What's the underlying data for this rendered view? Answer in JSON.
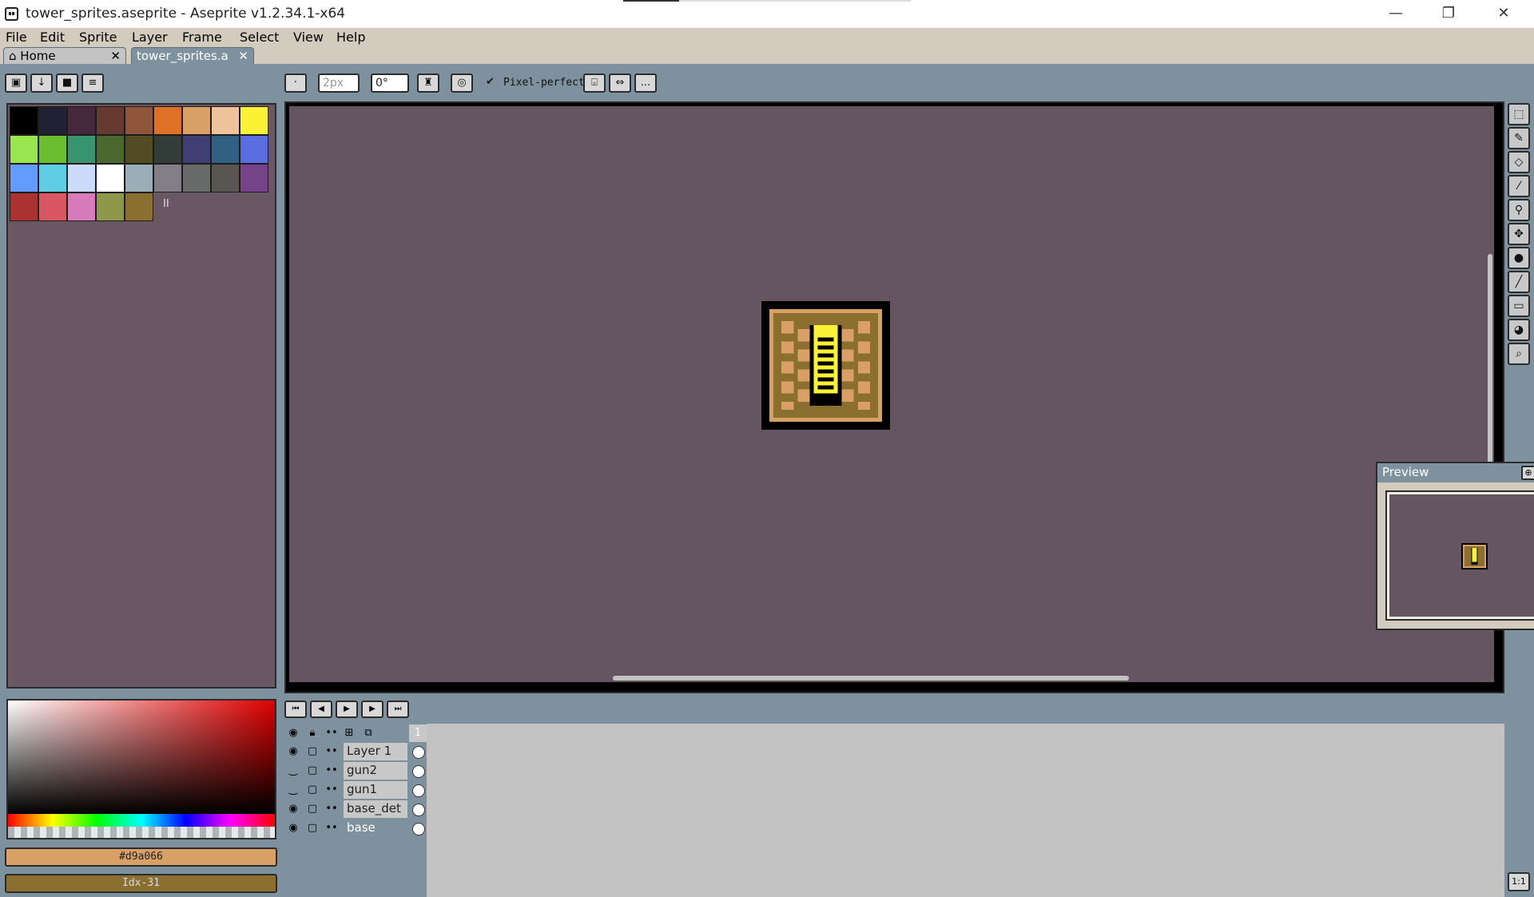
{
  "window": {
    "title": "tower_sprites.aseprite - Aseprite v1.2.34.1-x64",
    "minimize": "—",
    "restore": "❐",
    "close": "✕"
  },
  "menu": [
    "File",
    "Edit",
    "Sprite",
    "Layer",
    "Frame",
    "Select",
    "View",
    "Help"
  ],
  "tabs": {
    "home": "Home",
    "document": "tower_sprites.a",
    "close": "✕"
  },
  "toolbar": {
    "brush_size": "2px",
    "brush_angle": "0°",
    "pixel_perfect": "Pixel-perfect",
    "more": "..."
  },
  "palette": {
    "colors": [
      "#000000",
      "#222034",
      "#45283c",
      "#663931",
      "#8f563b",
      "#df7126",
      "#d9a066",
      "#eec39a",
      "#fbf236",
      "#99e550",
      "#6abe30",
      "#37946e",
      "#4b692f",
      "#524b24",
      "#323c39",
      "#3f3f74",
      "#306082",
      "#5b6ee1",
      "#639bff",
      "#5fcde4",
      "#cbdbfc",
      "#ffffff",
      "#9badb7",
      "#847e87",
      "#696a6a",
      "#595652",
      "#76428a",
      "#ac3232",
      "#d95763",
      "#d77bba",
      "#8f974a",
      "#8a6f30"
    ],
    "handle": "II"
  },
  "colors": {
    "foreground": "#d9a066",
    "background_index": "Idx-31",
    "background_swatch": "#8a6f30"
  },
  "preview": {
    "title": "Preview"
  },
  "timeline": {
    "frame_number": "1",
    "layers": [
      {
        "name": "Layer 1",
        "visible": true
      },
      {
        "name": "gun2",
        "visible": false
      },
      {
        "name": "gun1",
        "visible": false
      },
      {
        "name": "base_det",
        "visible": true
      },
      {
        "name": "base",
        "visible": true
      }
    ],
    "zoom": "1:1"
  },
  "icons": {
    "home": "house-icon",
    "lock": "lock-icon",
    "eye": "eye-icon"
  }
}
